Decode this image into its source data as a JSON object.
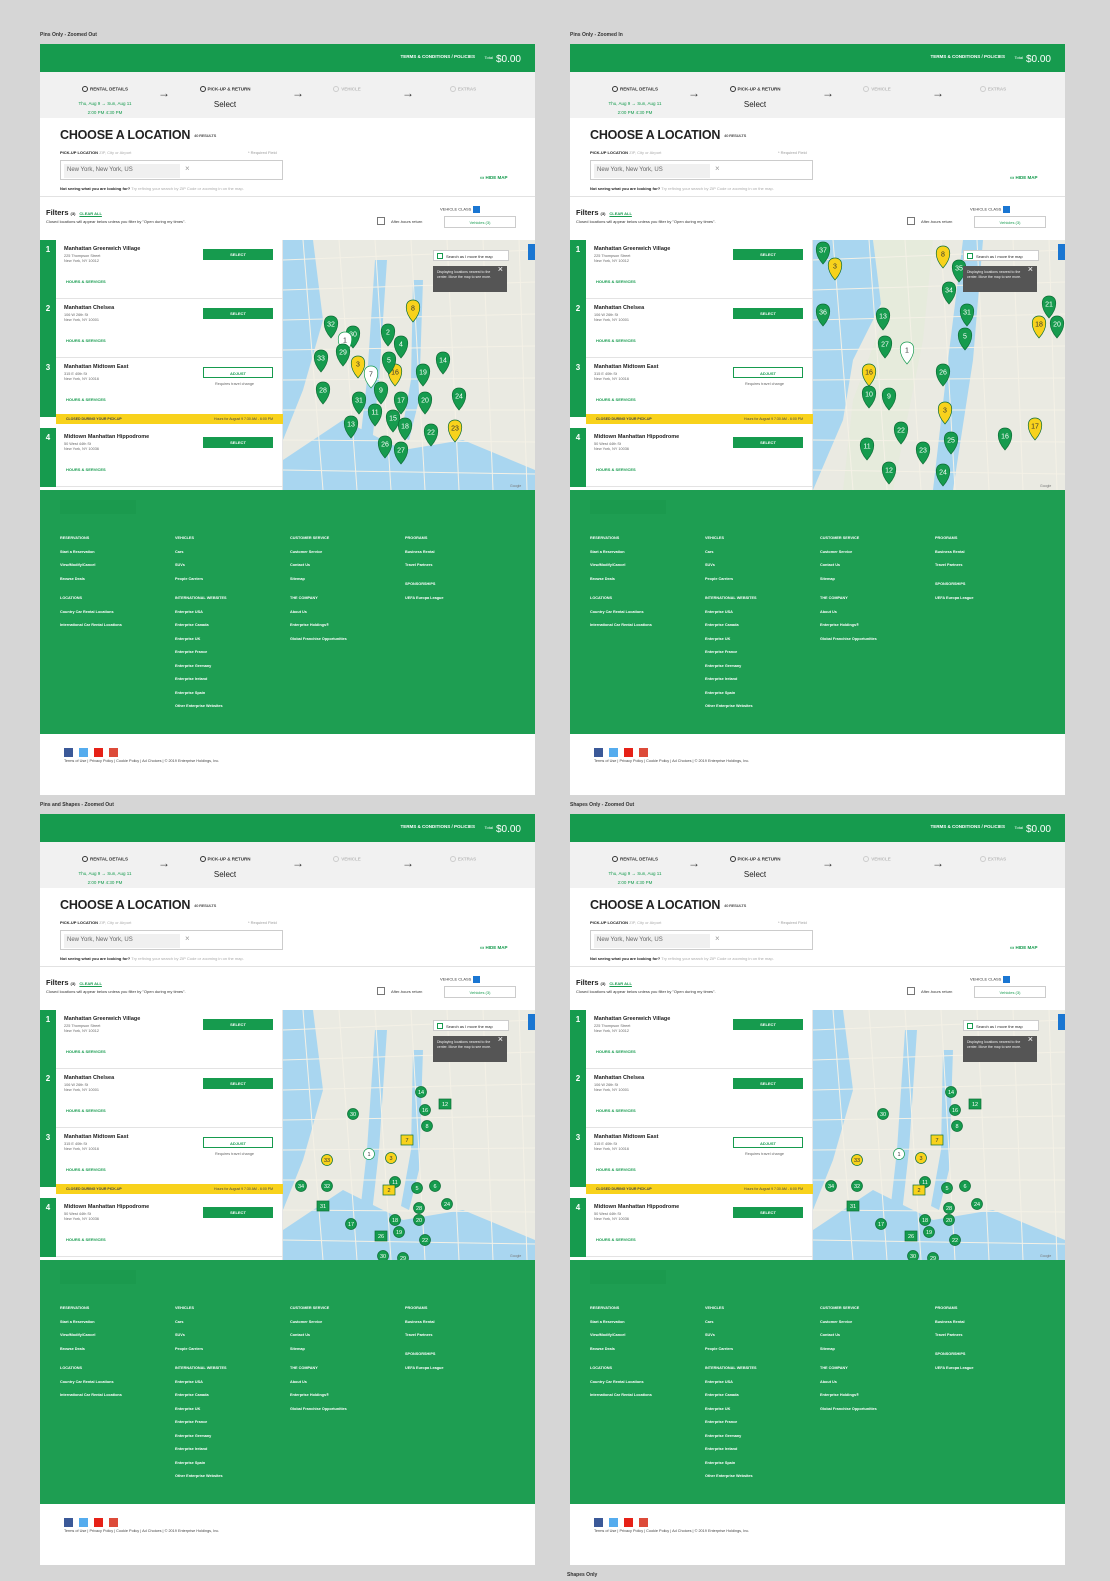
{
  "boards": [
    {
      "title": "Pins Only - Zoomed Out",
      "pin_mode": "pins",
      "zoom": "out"
    },
    {
      "title": "Pins Only - Zoomed In",
      "pin_mode": "pins",
      "zoom": "in"
    },
    {
      "title": "Pins and Shapes - Zoomed Out",
      "pin_mode": "shapes",
      "zoom": "out"
    },
    {
      "title": "Shapes Only - Zoomed Out",
      "pin_mode": "shapes",
      "zoom": "out"
    }
  ],
  "bottom_caption": "Shapes Only",
  "header": {
    "terms": "TERMS & CONDITIONS / POLICIES",
    "total_label": "Total",
    "total_value": "$0.00"
  },
  "steps": [
    {
      "label": "RENTAL DETAILS",
      "dates": "Thu, Aug 9 → Sun, Aug 11",
      "times": "2:00 PM    4:30 PM"
    },
    {
      "label": "PICK-UP & RETURN",
      "value": "Select"
    },
    {
      "label": "VEHICLE"
    },
    {
      "label": "EXTRAS"
    }
  ],
  "search": {
    "title": "CHOOSE A LOCATION",
    "results": "40 RESULTS",
    "pickup_label": "PICK-UP LOCATION",
    "pickup_hint": "ZIP, City or Airport",
    "required": "* Required Field",
    "value": "New York, New York, US",
    "hide_map": "HIDE MAP",
    "not_seeing": "Not seeing what you are looking for?",
    "not_seeing_hint": "Try refining your search by ZIP Code or zooming in on the map."
  },
  "filters": {
    "title": "Filters",
    "count": "(3)",
    "clear": "CLEAR ALL",
    "note": "Closed locations will appear below unless you filter by \"Open during my times\".",
    "vehicle_class": "VEHICLE CLASS",
    "after_hours": "After-hours return",
    "vehicles_selected": "Vehicles (3)"
  },
  "locations": [
    {
      "num": "1",
      "name": "Manhattan Greenwich Village",
      "addr1": "225 Thompson Street",
      "addr2": "New York, NY 10012",
      "btn": "SELECT",
      "hs": "HOURS & SERVICES"
    },
    {
      "num": "2",
      "name": "Manhattan Chelsea",
      "addr1": "106 W 26th St",
      "addr2": "New York, NY 10001",
      "btn": "SELECT",
      "hs": "HOURS & SERVICES"
    },
    {
      "num": "3",
      "name": "Manhattan Midtown East",
      "addr1": "315 E 40th St",
      "addr2": "New York, NY 10016",
      "btn": "ADJUST",
      "btn_note": "Requires travel change",
      "hs": "HOURS & SERVICES"
    },
    {
      "num": "4",
      "name": "Midtown Manhattan Hippodrome",
      "addr1": "50 West 44th St",
      "addr2": "New York, NY 10036",
      "btn": "SELECT",
      "hs": "HOURS & SERVICES"
    }
  ],
  "closed_banner": {
    "text": "CLOSED DURING YOUR PICK-UP",
    "hours": "Hours for August 9 7:30 AM - 6:00 PM"
  },
  "map": {
    "search_as_move": "Search as I move the map",
    "tooltip": "Displaying locations nearest to the center. Move the map to see more.",
    "google": "Google"
  },
  "footer": {
    "reservations": {
      "title": "RESERVATIONS",
      "items": [
        "Start a Reservation",
        "View/Modify/Cancel",
        "Browse Deals"
      ]
    },
    "vehicles": {
      "title": "VEHICLES",
      "items": [
        "Cars",
        "SUVs",
        "People Carriers"
      ]
    },
    "customer_service": {
      "title": "CUSTOMER SERVICE",
      "items": [
        "Customer Service",
        "Contact Us",
        "Sitemap"
      ]
    },
    "programs": {
      "title": "PROGRAMS",
      "items": [
        "Business Rental",
        "Travel Partners"
      ]
    },
    "sponsorships": {
      "title": "SPONSORSHIPS",
      "items": [
        "UEFA Europa League"
      ]
    },
    "locations": {
      "title": "LOCATIONS",
      "items": [
        "Country Car Rental Locations",
        "International Car Rental Locations"
      ]
    },
    "international": {
      "title": "INTERNATIONAL WEBSITES",
      "items": [
        "Enterprise USA",
        "Enterprise Canada",
        "Enterprise UK",
        "Enterprise France",
        "Enterprise Germany",
        "Enterprise Ireland",
        "Enterprise Spain",
        "Other Enterprise Websites"
      ]
    },
    "company": {
      "title": "THE COMPANY",
      "items": [
        "About Us",
        "Enterprise Holdings®",
        "Global Franchise Opportunities"
      ]
    }
  },
  "legal": "Terms of Use | Privacy Policy | Cookie Policy | Ad Choices | © 2019 Enterprise Holdings, Inc.",
  "colors": {
    "brand_green": "#169b4e",
    "dark_green": "#0e7a3c",
    "pin_yellow": "#f8d21c",
    "closed_yellow": "#f8d21c",
    "info_blue": "#1a76d2"
  },
  "icons": [
    "checkmark-circle-icon",
    "arrow-right-icon",
    "close-icon",
    "facebook-icon",
    "twitter-icon",
    "youtube-icon",
    "google-plus-icon",
    "map-icon",
    "calendar-icon"
  ],
  "pin_sets": {
    "out": [
      {
        "n": "8",
        "c": "y"
      },
      {
        "n": "32",
        "c": "g"
      },
      {
        "n": "30",
        "c": "g"
      },
      {
        "n": "1",
        "c": "w"
      },
      {
        "n": "2",
        "c": "g"
      },
      {
        "n": "4",
        "c": "g"
      },
      {
        "n": "29",
        "c": "g"
      },
      {
        "n": "33",
        "c": "g"
      },
      {
        "n": "3",
        "c": "y"
      },
      {
        "n": "7",
        "c": "w"
      },
      {
        "n": "16",
        "c": "y"
      },
      {
        "n": "5",
        "c": "g"
      },
      {
        "n": "14",
        "c": "g"
      },
      {
        "n": "19",
        "c": "g"
      },
      {
        "n": "9",
        "c": "g"
      },
      {
        "n": "17",
        "c": "g"
      },
      {
        "n": "20",
        "c": "g"
      },
      {
        "n": "24",
        "c": "g"
      },
      {
        "n": "11",
        "c": "g"
      },
      {
        "n": "15",
        "c": "g"
      },
      {
        "n": "13",
        "c": "g"
      },
      {
        "n": "18",
        "c": "g"
      },
      {
        "n": "23",
        "c": "y"
      },
      {
        "n": "22",
        "c": "g"
      },
      {
        "n": "26",
        "c": "g"
      },
      {
        "n": "27",
        "c": "g"
      },
      {
        "n": "31",
        "c": "g"
      },
      {
        "n": "28",
        "c": "g"
      }
    ],
    "in": [
      {
        "n": "37",
        "c": "g"
      },
      {
        "n": "8",
        "c": "y"
      },
      {
        "n": "3",
        "c": "y"
      },
      {
        "n": "35",
        "c": "g"
      },
      {
        "n": "34",
        "c": "g"
      },
      {
        "n": "36",
        "c": "g"
      },
      {
        "n": "13",
        "c": "g"
      },
      {
        "n": "31",
        "c": "g"
      },
      {
        "n": "21",
        "c": "g"
      },
      {
        "n": "18",
        "c": "y"
      },
      {
        "n": "20",
        "c": "g"
      },
      {
        "n": "27",
        "c": "g"
      },
      {
        "n": "1",
        "c": "w"
      },
      {
        "n": "5",
        "c": "g"
      },
      {
        "n": "16",
        "c": "y"
      },
      {
        "n": "26",
        "c": "g"
      },
      {
        "n": "10",
        "c": "g"
      },
      {
        "n": "9",
        "c": "g"
      },
      {
        "n": "3",
        "c": "y"
      },
      {
        "n": "17",
        "c": "y"
      },
      {
        "n": "22",
        "c": "g"
      },
      {
        "n": "16",
        "c": "g"
      },
      {
        "n": "11",
        "c": "g"
      },
      {
        "n": "25",
        "c": "g"
      },
      {
        "n": "12",
        "c": "g"
      },
      {
        "n": "24",
        "c": "g"
      },
      {
        "n": "23",
        "c": "g"
      }
    ],
    "shapes": [
      {
        "n": "14",
        "c": "g"
      },
      {
        "n": "16",
        "c": "g"
      },
      {
        "n": "12",
        "c": "g"
      },
      {
        "n": "30",
        "c": "g"
      },
      {
        "n": "33",
        "c": "y"
      },
      {
        "n": "1",
        "c": "w"
      },
      {
        "n": "3",
        "c": "y"
      },
      {
        "n": "7",
        "c": "y"
      },
      {
        "n": "8",
        "c": "g"
      },
      {
        "n": "11",
        "c": "g"
      },
      {
        "n": "34",
        "c": "g"
      },
      {
        "n": "32",
        "c": "g"
      },
      {
        "n": "2",
        "c": "y"
      },
      {
        "n": "5",
        "c": "g"
      },
      {
        "n": "6",
        "c": "g"
      },
      {
        "n": "28",
        "c": "g"
      },
      {
        "n": "24",
        "c": "g"
      },
      {
        "n": "31",
        "c": "g"
      },
      {
        "n": "17",
        "c": "g"
      },
      {
        "n": "18",
        "c": "g"
      },
      {
        "n": "19",
        "c": "g"
      },
      {
        "n": "20",
        "c": "g"
      },
      {
        "n": "26",
        "c": "g"
      },
      {
        "n": "22",
        "c": "g"
      },
      {
        "n": "30",
        "c": "g"
      },
      {
        "n": "29",
        "c": "g"
      }
    ]
  }
}
